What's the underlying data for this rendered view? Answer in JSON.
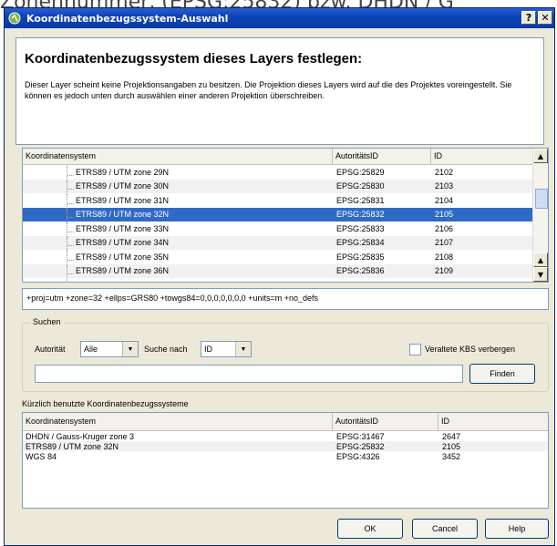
{
  "background_text": "Zonennummer, (EPSG:25832) bzw. DHDN / G",
  "window": {
    "title": "Koordinatenbezugssystem-Auswahl",
    "help_btn": "?",
    "close_btn": "✕"
  },
  "header": {
    "heading": "Koordinatenbezugssystem dieses Layers festlegen:",
    "description": "Dieser Layer scheint keine Projektionsangaben zu besitzen. Die Projektion dieses Layers wird auf die des Projektes voreingestellt. Sie können es jedoch unten durch auswählen einer anderen Projektion überschreiben."
  },
  "crs_table": {
    "columns": [
      "Koordinatensystem",
      "AutoritätsID",
      "ID"
    ],
    "rows": [
      {
        "name": "ETRS89 / UTM zone 29N",
        "authid": "EPSG:25829",
        "id": "2102"
      },
      {
        "name": "ETRS89 / UTM zone 30N",
        "authid": "EPSG:25830",
        "id": "2103"
      },
      {
        "name": "ETRS89 / UTM zone 31N",
        "authid": "EPSG:25831",
        "id": "2104"
      },
      {
        "name": "ETRS89 / UTM zone 32N",
        "authid": "EPSG:25832",
        "id": "2105"
      },
      {
        "name": "ETRS89 / UTM zone 33N",
        "authid": "EPSG:25833",
        "id": "2106"
      },
      {
        "name": "ETRS89 / UTM zone 34N",
        "authid": "EPSG:25834",
        "id": "2107"
      },
      {
        "name": "ETRS89 / UTM zone 35N",
        "authid": "EPSG:25835",
        "id": "2108"
      },
      {
        "name": "ETRS89 / UTM zone 36N",
        "authid": "EPSG:25836",
        "id": "2109"
      }
    ],
    "selected_row": "ETRS89 / UTM zone 32N"
  },
  "proj_string": "+proj=utm +zone=32 +ellps=GRS80 +towgs84=0,0,0,0,0,0,0 +units=m +no_defs",
  "search": {
    "legend": "Suchen",
    "authority_label": "Autorität",
    "authority_value": "Alle",
    "search_by_label": "Suche nach",
    "search_by_value": "ID",
    "hide_deprecated_label": "Veraltete KBS verbergen",
    "query_value": "",
    "find_button": "Finden"
  },
  "recent": {
    "label": "Kürzlich benutzte Koordinatenbezugssysteme",
    "columns": [
      "Koordinatensystem",
      "AutoritätsID",
      "ID"
    ],
    "rows": [
      {
        "name": "DHDN / Gauss-Kruger zone 3",
        "authid": "EPSG:31467",
        "id": "2647"
      },
      {
        "name": "ETRS89 / UTM zone 32N",
        "authid": "EPSG:25832",
        "id": "2105"
      },
      {
        "name": "WGS 84",
        "authid": "EPSG:4326",
        "id": "3452"
      }
    ]
  },
  "buttons": {
    "ok": "OK",
    "cancel": "Cancel",
    "help": "Help"
  },
  "colors": {
    "titlebar": "#0d43b8",
    "selection": "#316ac5",
    "dialog_bg": "#ece9d8"
  }
}
